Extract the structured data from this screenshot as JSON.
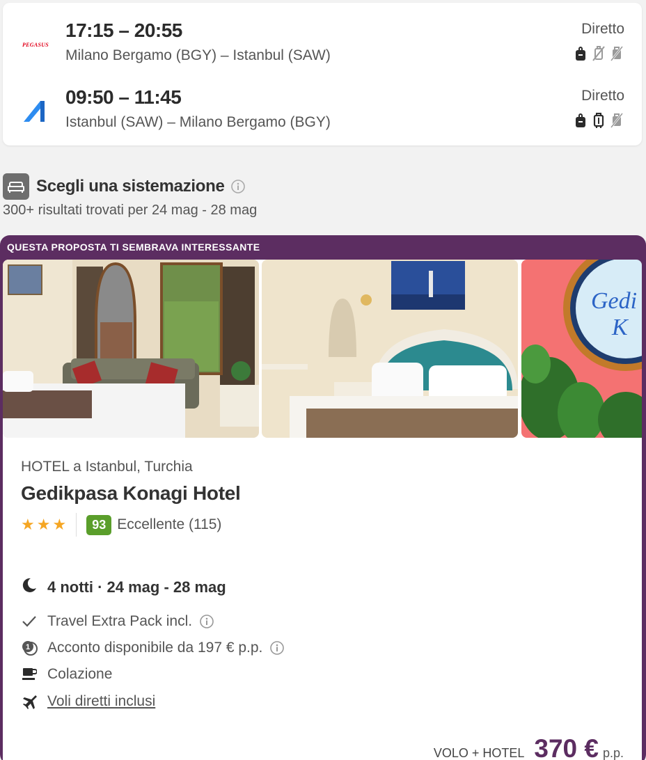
{
  "flights": [
    {
      "airline": "PEGASUS",
      "logo_icon": "pegasus-logo",
      "times": "17:15 – 20:55",
      "route": "Milano Bergamo (BGY) – Istanbul (SAW)",
      "type": "Diretto",
      "bags": [
        "backpack-icon",
        "trolley-crossed-icon",
        "checked-bag-crossed-icon"
      ]
    },
    {
      "airline": "AJet",
      "logo_icon": "ajet-logo",
      "times": "09:50 – 11:45",
      "route": "Istanbul (SAW) – Milano Bergamo (BGY)",
      "type": "Diretto",
      "bags": [
        "backpack-icon",
        "trolley-icon",
        "checked-bag-crossed-icon"
      ]
    }
  ],
  "accommodation": {
    "title": "Scegli una sistemazione",
    "results": "300+ risultati trovati per 24 mag - 28 mag"
  },
  "offer": {
    "banner": "QUESTA PROPOSTA TI SEMBRAVA INTERESSANTE",
    "hotel_location": "HOTEL a Istanbul, Turchia",
    "hotel_name": "Gedikpasa Konagi Hotel",
    "stars": 3,
    "score": "93",
    "score_label": "Eccellente (115)",
    "nights": "4 notti · 24 mag - 28 mag",
    "features": {
      "extra_pack": "Travel Extra Pack incl.",
      "deposit": "Acconto disponibile da 197 € p.p.",
      "breakfast": "Colazione",
      "direct_flights": "Voli diretti inclusi"
    },
    "price_label": "VOLO + HOTEL",
    "price": "370 €",
    "price_unit": "p.p."
  },
  "colors": {
    "brand_purple": "#5c2d61",
    "score_green": "#5a9e2b",
    "star_orange": "#f5a623",
    "pegasus_red": "#e2001a",
    "ajet_blue": "#2d8cf0"
  }
}
